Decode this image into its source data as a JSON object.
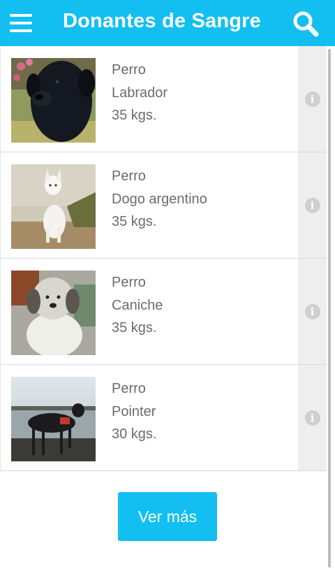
{
  "app": {
    "title": "Donantes de Sangre"
  },
  "icons": {
    "menu": "hamburger-menu-icon",
    "search": "search-icon",
    "info": "info-icon"
  },
  "colors": {
    "primary": "#13bff0",
    "text": "#6b6b6b",
    "info_bg": "#eeeeee"
  },
  "donors": [
    {
      "species": "Perro",
      "breed": "Labrador",
      "weight": "35 kgs.",
      "info_glyph": "i"
    },
    {
      "species": "Perro",
      "breed": "Dogo argentino",
      "weight": "35 kgs.",
      "info_glyph": "i"
    },
    {
      "species": "Perro",
      "breed": "Caniche",
      "weight": "35 kgs.",
      "info_glyph": "i"
    },
    {
      "species": "Perro",
      "breed": "Pointer",
      "weight": "30 kgs.",
      "info_glyph": "i"
    }
  ],
  "more_button": {
    "label": "Ver más"
  }
}
